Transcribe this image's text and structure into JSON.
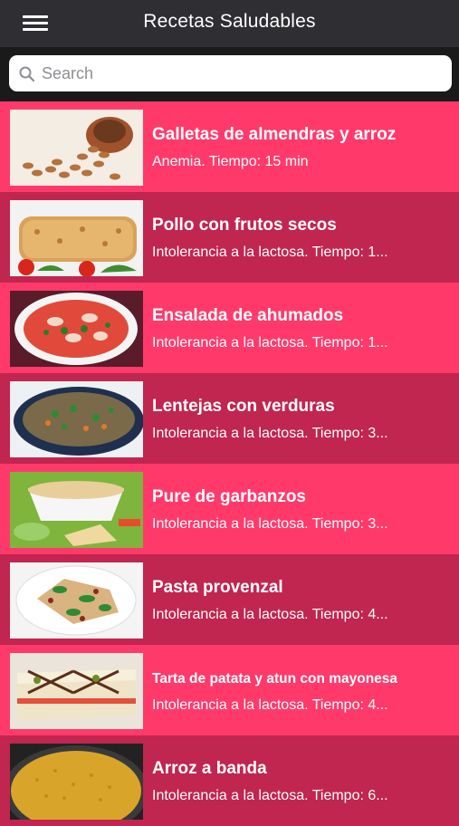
{
  "header": {
    "title": "Recetas Saludables",
    "menu_icon": "hamburger-menu-icon"
  },
  "search": {
    "placeholder": "Search",
    "value": "",
    "icon": "search-icon"
  },
  "colors": {
    "row_light": "#ff3a6b",
    "row_dark": "#c0264f",
    "navbar": "#2f2f33"
  },
  "recipes": [
    {
      "title": "Galletas de almendras y arroz",
      "subtitle": "Anemia. Tiempo: 15 min"
    },
    {
      "title": "Pollo con frutos secos",
      "subtitle": "Intolerancia a la lactosa. Tiempo: 1..."
    },
    {
      "title": "Ensalada de ahumados",
      "subtitle": "Intolerancia a la lactosa. Tiempo: 1..."
    },
    {
      "title": "Lentejas con verduras",
      "subtitle": "Intolerancia a la lactosa. Tiempo: 3..."
    },
    {
      "title": "Pure de garbanzos",
      "subtitle": "Intolerancia a la lactosa. Tiempo: 3..."
    },
    {
      "title": "Pasta provenzal",
      "subtitle": "Intolerancia a la lactosa. Tiempo: 4..."
    },
    {
      "title": "Tarta de patata y atun con mayonesa",
      "subtitle": "Intolerancia a la lactosa. Tiempo: 4..."
    },
    {
      "title": "Arroz a banda",
      "subtitle": "Intolerancia a la lactosa. Tiempo: 6..."
    }
  ]
}
